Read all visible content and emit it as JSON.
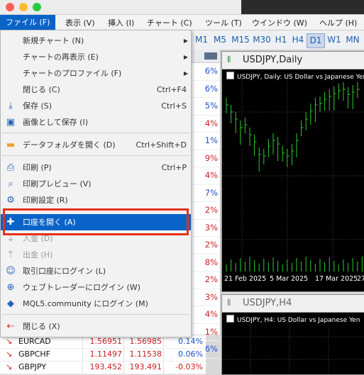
{
  "window": {
    "lights": [
      "#fe5f57",
      "#febc2e",
      "#28c840"
    ]
  },
  "menubar": {
    "items": [
      "ファイル (F)",
      "表示 (V)",
      "挿入 (I)",
      "チャート (C)",
      "ツール (T)",
      "ウインドウ (W)",
      "ヘルプ (H)"
    ]
  },
  "timeframes": {
    "items": [
      "M1",
      "M5",
      "M15",
      "M30",
      "H1",
      "H4",
      "D1",
      "W1",
      "MN"
    ],
    "selected": "D1"
  },
  "file_menu": {
    "items": [
      {
        "label": "新規チャート (N)",
        "shortcut": "",
        "submenu": true,
        "icon": "",
        "disabled": false
      },
      {
        "label": "チャートの再表示 (E)",
        "shortcut": "",
        "submenu": true,
        "icon": "",
        "disabled": false
      },
      {
        "label": "チャートのプロファイル (F)",
        "shortcut": "",
        "submenu": true,
        "icon": "",
        "disabled": false
      },
      {
        "label": "閉じる (C)",
        "shortcut": "Ctrl+F4",
        "submenu": false,
        "icon": "",
        "disabled": false
      },
      {
        "label": "保存 (S)",
        "shortcut": "Ctrl+S",
        "submenu": false,
        "icon": "save-icon",
        "disabled": false
      },
      {
        "label": "画像として保存 (I)",
        "shortcut": "",
        "submenu": false,
        "icon": "image-icon",
        "disabled": false
      },
      {
        "label": "データフォルダを開く (D)",
        "shortcut": "Ctrl+Shift+D",
        "submenu": false,
        "icon": "folder-icon",
        "disabled": false
      },
      {
        "label": "印刷 (P)",
        "shortcut": "Ctrl+P",
        "submenu": false,
        "icon": "printer-icon",
        "disabled": false
      },
      {
        "label": "印刷プレビュー (V)",
        "shortcut": "",
        "submenu": false,
        "icon": "print-preview-icon",
        "disabled": false
      },
      {
        "label": "印刷設定 (R)",
        "shortcut": "",
        "submenu": false,
        "icon": "print-settings-icon",
        "disabled": false
      },
      {
        "label": "口座を開く (A)",
        "shortcut": "",
        "submenu": false,
        "icon": "open-account-icon",
        "disabled": false,
        "highlight": true
      },
      {
        "label": "入金 (D)",
        "shortcut": "",
        "submenu": false,
        "icon": "deposit-icon",
        "disabled": true
      },
      {
        "label": "出金 (H)",
        "shortcut": "",
        "submenu": false,
        "icon": "withdraw-icon",
        "disabled": true
      },
      {
        "label": "取引口座にログイン (L)",
        "shortcut": "",
        "submenu": false,
        "icon": "user-icon",
        "disabled": false
      },
      {
        "label": "ウェブトレーダーにログイン (W)",
        "shortcut": "",
        "submenu": false,
        "icon": "globe-icon",
        "disabled": false
      },
      {
        "label": "MQL5.community にログイン (M)",
        "shortcut": "",
        "submenu": false,
        "icon": "mql5-icon",
        "disabled": false
      },
      {
        "label": "閉じる (X)",
        "shortcut": "",
        "submenu": false,
        "icon": "exit-icon",
        "disabled": false
      }
    ]
  },
  "market_watch_changes": [
    "6%",
    "6%",
    "5%",
    "4%",
    "1%",
    "9%",
    "4%",
    "7%",
    "2%",
    "3%",
    "2%",
    "8%",
    "2%",
    "3%",
    "4%",
    "1%",
    "6%"
  ],
  "charts": [
    {
      "tab_title": "USDJPY,Daily",
      "subtitle": "USDJPY, Daily:  US Dollar vs Japanese Yen",
      "dates": [
        "21 Feb 2025",
        "5 Mar 2025",
        "17 Mar 2025",
        "27"
      ]
    },
    {
      "tab_title": "USDJPY,H4",
      "subtitle": "USDJPY, H4:  US Dollar vs Japanese Yen",
      "dates": []
    }
  ],
  "quotes": [
    {
      "symbol": "EURCAD",
      "bid": "1.56951",
      "ask": "1.56985",
      "change": "0.14%"
    },
    {
      "symbol": "GBPCHF",
      "bid": "1.11497",
      "ask": "1.11538",
      "change": "0.06%"
    },
    {
      "symbol": "GBPJPY",
      "bid": "193.452",
      "ask": "193.491",
      "change": "-0.03%"
    }
  ]
}
